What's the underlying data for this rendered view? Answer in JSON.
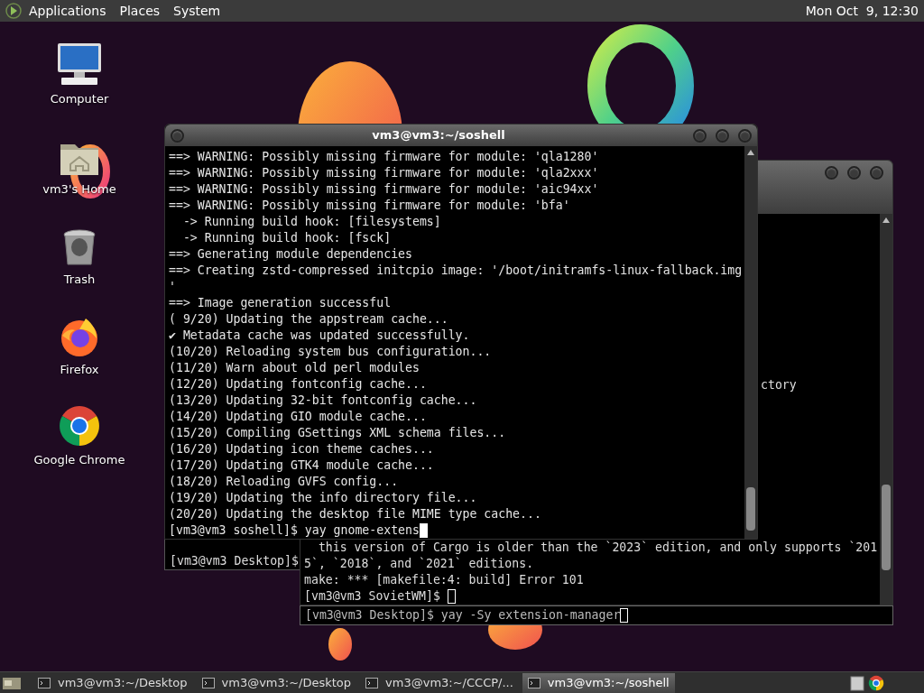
{
  "top_panel": {
    "menus": [
      "Applications",
      "Places",
      "System"
    ],
    "clock": "Mon Oct  9, 12:30"
  },
  "desktop_icons": [
    {
      "kind": "computer",
      "label": "Computer"
    },
    {
      "kind": "home",
      "label": "vm3's Home"
    },
    {
      "kind": "trash",
      "label": "Trash"
    },
    {
      "kind": "firefox",
      "label": "Firefox"
    },
    {
      "kind": "chrome",
      "label": "Google Chrome"
    }
  ],
  "back_terminal_left": {
    "lines": [
      "[vm3@vm3 Desktop]$"
    ]
  },
  "back_terminal_right": {
    "partial_line": "ctory",
    "lines": [
      "  this version of Cargo is older than the `2023` edition, and only supports `201",
      "5`, `2018`, and `2021` editions.",
      "make: *** [makefile:4: build] Error 101"
    ],
    "prompt": "[vm3@vm3 SovietWM]$ ",
    "focused": false
  },
  "back_terminal_bottom": {
    "prompt": "[vm3@vm3 Desktop]$ yay -Sy extension-manager",
    "focused": false
  },
  "front_terminal": {
    "title": "vm3@vm3:~/soshell",
    "lines": [
      "==> WARNING: Possibly missing firmware for module: 'qla1280'",
      "==> WARNING: Possibly missing firmware for module: 'qla2xxx'",
      "==> WARNING: Possibly missing firmware for module: 'aic94xx'",
      "==> WARNING: Possibly missing firmware for module: 'bfa'",
      "  -> Running build hook: [filesystems]",
      "  -> Running build hook: [fsck]",
      "==> Generating module dependencies",
      "==> Creating zstd-compressed initcpio image: '/boot/initramfs-linux-fallback.img",
      "'",
      "==> Image generation successful",
      "( 9/20) Updating the appstream cache...",
      "✔ Metadata cache was updated successfully.",
      "(10/20) Reloading system bus configuration...",
      "(11/20) Warn about old perl modules",
      "(12/20) Updating fontconfig cache...",
      "(13/20) Updating 32-bit fontconfig cache...",
      "(14/20) Updating GIO module cache...",
      "(15/20) Compiling GSettings XML schema files...",
      "(16/20) Updating icon theme caches...",
      "(17/20) Updating GTK4 module cache...",
      "(18/20) Reloading GVFS config...",
      "(19/20) Updating the info directory file...",
      "(20/20) Updating the desktop file MIME type cache..."
    ],
    "prompt": "[vm3@vm3 soshell]$ yay gnome-extens",
    "focused": true
  },
  "taskbar": {
    "tasks": [
      {
        "label": "vm3@vm3:~/Desktop",
        "selected": false
      },
      {
        "label": "vm3@vm3:~/Desktop",
        "selected": false
      },
      {
        "label": "vm3@vm3:~/CCCP/...",
        "selected": false
      },
      {
        "label": "vm3@vm3:~/soshell",
        "selected": true
      }
    ]
  }
}
